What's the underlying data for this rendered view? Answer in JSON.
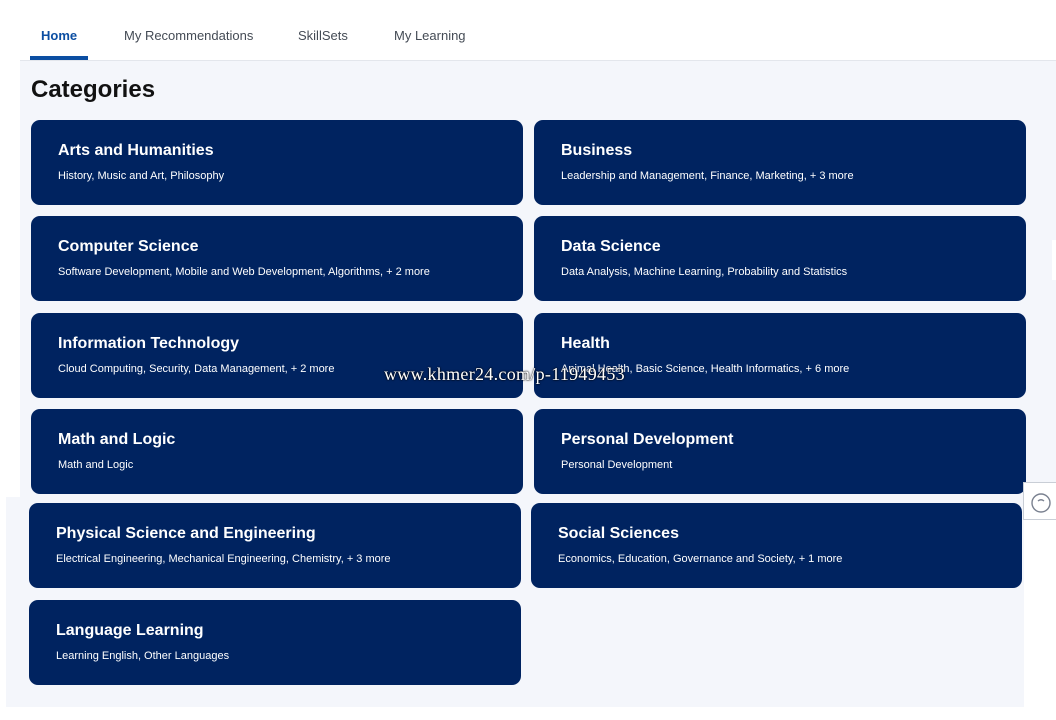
{
  "tabs": [
    {
      "label": "Home",
      "active": true
    },
    {
      "label": "My Recommendations",
      "active": false
    },
    {
      "label": "SkillSets",
      "active": false
    },
    {
      "label": "My Learning",
      "active": false
    }
  ],
  "page_title": "Categories",
  "categories": [
    {
      "title": "Arts and Humanities",
      "subtitle": "History, Music and Art, Philosophy"
    },
    {
      "title": "Business",
      "subtitle": "Leadership and Management, Finance, Marketing, + 3 more"
    },
    {
      "title": "Computer Science",
      "subtitle": "Software Development, Mobile and Web Development, Algorithms, + 2 more"
    },
    {
      "title": "Data Science",
      "subtitle": "Data Analysis, Machine Learning, Probability and Statistics"
    },
    {
      "title": "Information Technology",
      "subtitle": "Cloud Computing, Security, Data Management, + 2 more"
    },
    {
      "title": "Health",
      "subtitle": "Animal Health, Basic Science, Health Informatics, + 6 more"
    },
    {
      "title": "Math and Logic",
      "subtitle": "Math and Logic"
    },
    {
      "title": "Personal Development",
      "subtitle": "Personal Development"
    },
    {
      "title": "Physical Science and Engineering",
      "subtitle": "Electrical Engineering, Mechanical Engineering, Chemistry, + 3 more"
    },
    {
      "title": "Social Sciences",
      "subtitle": "Economics, Education, Governance and Society, + 1 more"
    },
    {
      "title": "Language Learning",
      "subtitle": "Learning English, Other Languages"
    }
  ],
  "watermark": "www.khmer24.com/p-11949453",
  "colors": {
    "card_bg": "#002360",
    "accent": "#0b4ea2",
    "panel_bg": "#f4f6fb"
  },
  "icons": {
    "help": "help-circle-icon"
  }
}
